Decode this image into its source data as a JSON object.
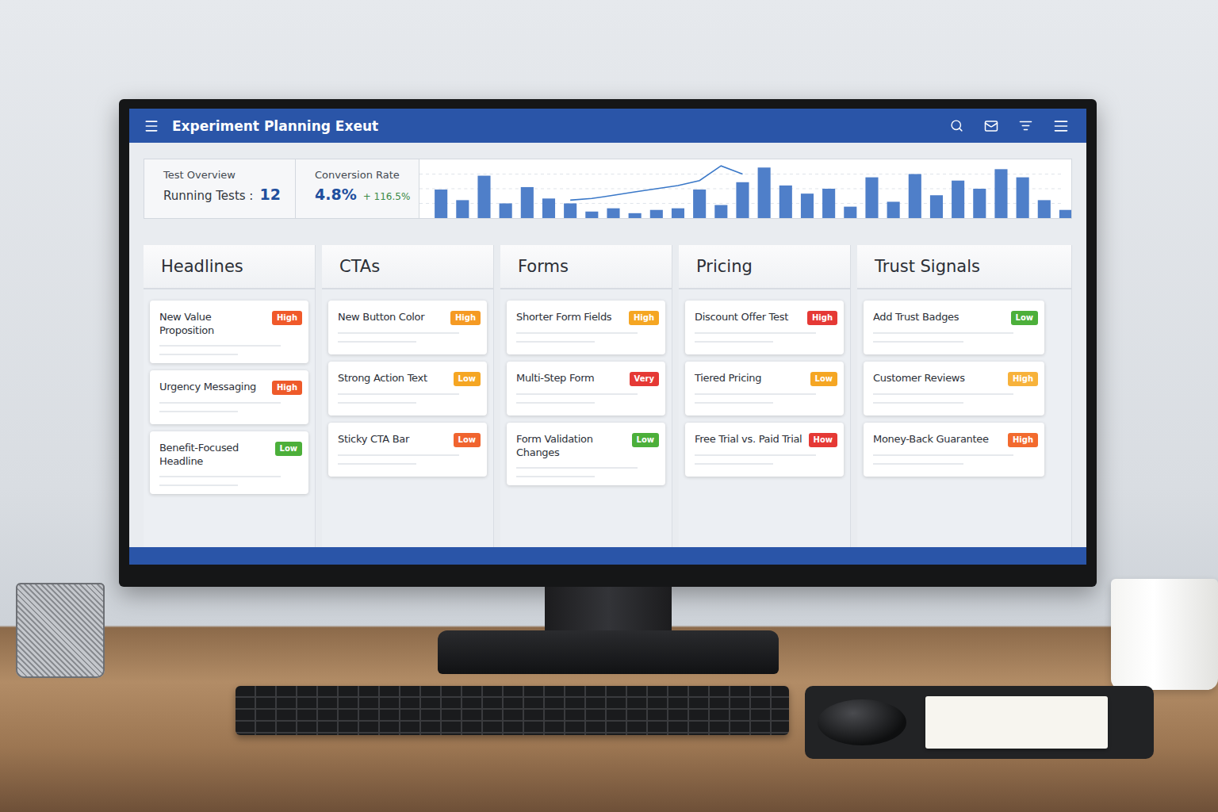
{
  "window": {
    "title": "Experiment Planning Exeut"
  },
  "stats": {
    "test_overview": {
      "label": "Test Overview",
      "metric": "Running Tests :",
      "value": "12"
    },
    "conversion": {
      "label": "Conversion Rate",
      "value": "4.8%",
      "change": "+ 116.5%"
    }
  },
  "chart": {
    "bars": [
      35,
      22,
      52,
      18,
      38,
      24,
      18,
      8,
      12,
      6,
      10,
      12,
      35,
      16,
      44,
      62,
      40,
      30,
      36,
      14,
      50,
      20,
      54,
      28,
      46,
      36,
      60,
      50,
      22,
      10
    ],
    "line": {
      "start_index": 6,
      "values": [
        22,
        24,
        28,
        32,
        36,
        40,
        46,
        64,
        54
      ]
    }
  },
  "columns": [
    {
      "title": "Headlines",
      "cards": [
        {
          "title": "New Value Proposition",
          "badge": "High",
          "color": "#f0592a"
        },
        {
          "title": "Urgency Messaging",
          "badge": "High",
          "color": "#ee5a2a"
        },
        {
          "title": "Benefit-Focused Headline",
          "badge": "Low",
          "color": "#4caf3a"
        }
      ]
    },
    {
      "title": "CTAs",
      "cards": [
        {
          "title": "New Button Color",
          "badge": "High",
          "color": "#f59a23"
        },
        {
          "title": "Strong Action Text",
          "badge": "Low",
          "color": "#f5a623"
        },
        {
          "title": "Sticky CTA Bar",
          "badge": "Low",
          "color": "#f0642f"
        }
      ]
    },
    {
      "title": "Forms",
      "cards": [
        {
          "title": "Shorter Form Fields",
          "badge": "High",
          "color": "#f5a623"
        },
        {
          "title": "Multi-Step Form",
          "badge": "Very",
          "color": "#e53935"
        },
        {
          "title": "Form Validation Changes",
          "badge": "Low",
          "color": "#4caf3a"
        }
      ]
    },
    {
      "title": "Pricing",
      "cards": [
        {
          "title": "Discount Offer Test",
          "badge": "High",
          "color": "#e53935"
        },
        {
          "title": "Tiered Pricing",
          "badge": "Low",
          "color": "#f5a623"
        },
        {
          "title": "Free Trial vs. Paid Trial",
          "badge": "How",
          "color": "#e53935"
        }
      ]
    },
    {
      "title": "Trust Signals",
      "cards": [
        {
          "title": "Add Trust Badges",
          "badge": "Low",
          "color": "#4caf3a"
        },
        {
          "title": "Customer Reviews",
          "badge": "High",
          "color": "#f7b23b"
        },
        {
          "title": "Money-Back Guarantee",
          "badge": "High",
          "color": "#f26a2e"
        }
      ]
    }
  ]
}
